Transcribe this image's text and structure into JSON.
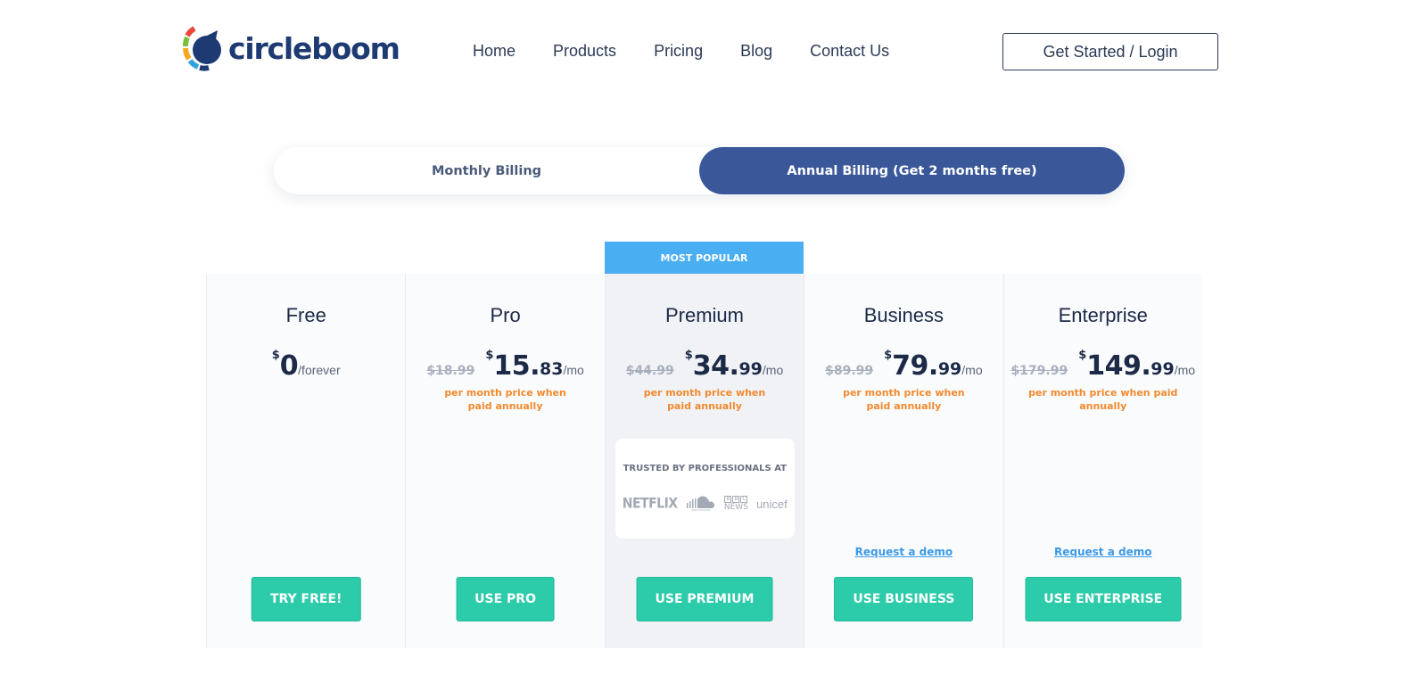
{
  "brand": {
    "name": "circleboom"
  },
  "nav": [
    {
      "label": "Home"
    },
    {
      "label": "Products"
    },
    {
      "label": "Pricing"
    },
    {
      "label": "Blog"
    },
    {
      "label": "Contact Us"
    }
  ],
  "login_label": "Get Started / Login",
  "billing": {
    "monthly_label": "Monthly Billing",
    "annual_label": "Annual Billing (Get 2 months free)",
    "selected": "annual"
  },
  "popular_badge": "MOST POPULAR",
  "plans": [
    {
      "name": "Free",
      "old_price": "",
      "currency": "$",
      "price": "0",
      "cents": "",
      "period": "/forever",
      "note": "",
      "demo_link": "",
      "cta": "TRY FREE!"
    },
    {
      "name": "Pro",
      "old_price": "$18.99",
      "currency": "$",
      "price": "15.",
      "cents": "83",
      "period": "/mo",
      "note": "per month price when paid annually",
      "demo_link": "",
      "cta": "USE PRO"
    },
    {
      "name": "Premium",
      "old_price": "$44.99",
      "currency": "$",
      "price": "34.",
      "cents": "99",
      "period": "/mo",
      "note": "per month price when paid annually",
      "demo_link": "",
      "cta": "USE PREMIUM"
    },
    {
      "name": "Business",
      "old_price": "$89.99",
      "currency": "$",
      "price": "79.",
      "cents": "99",
      "period": "/mo",
      "note": "per month price when paid annually",
      "demo_link": "Request a demo",
      "cta": "USE BUSINESS"
    },
    {
      "name": "Enterprise",
      "old_price": "$179.99",
      "currency": "$",
      "price": "149.",
      "cents": "99",
      "period": "/mo",
      "note": "per month price when paid annually",
      "demo_link": "Request a demo",
      "cta": "USE ENTERPRISE"
    }
  ],
  "trusted": {
    "title": "TRUSTED BY PROFESSIONALS AT",
    "brands": [
      "NETFLIX",
      "SoundCloud",
      "BBC NEWS",
      "unicef"
    ]
  },
  "colors": {
    "accent": "#3a5899",
    "cta": "#2ccbaa",
    "badge": "#4aaef2",
    "note": "#f28a2e"
  }
}
